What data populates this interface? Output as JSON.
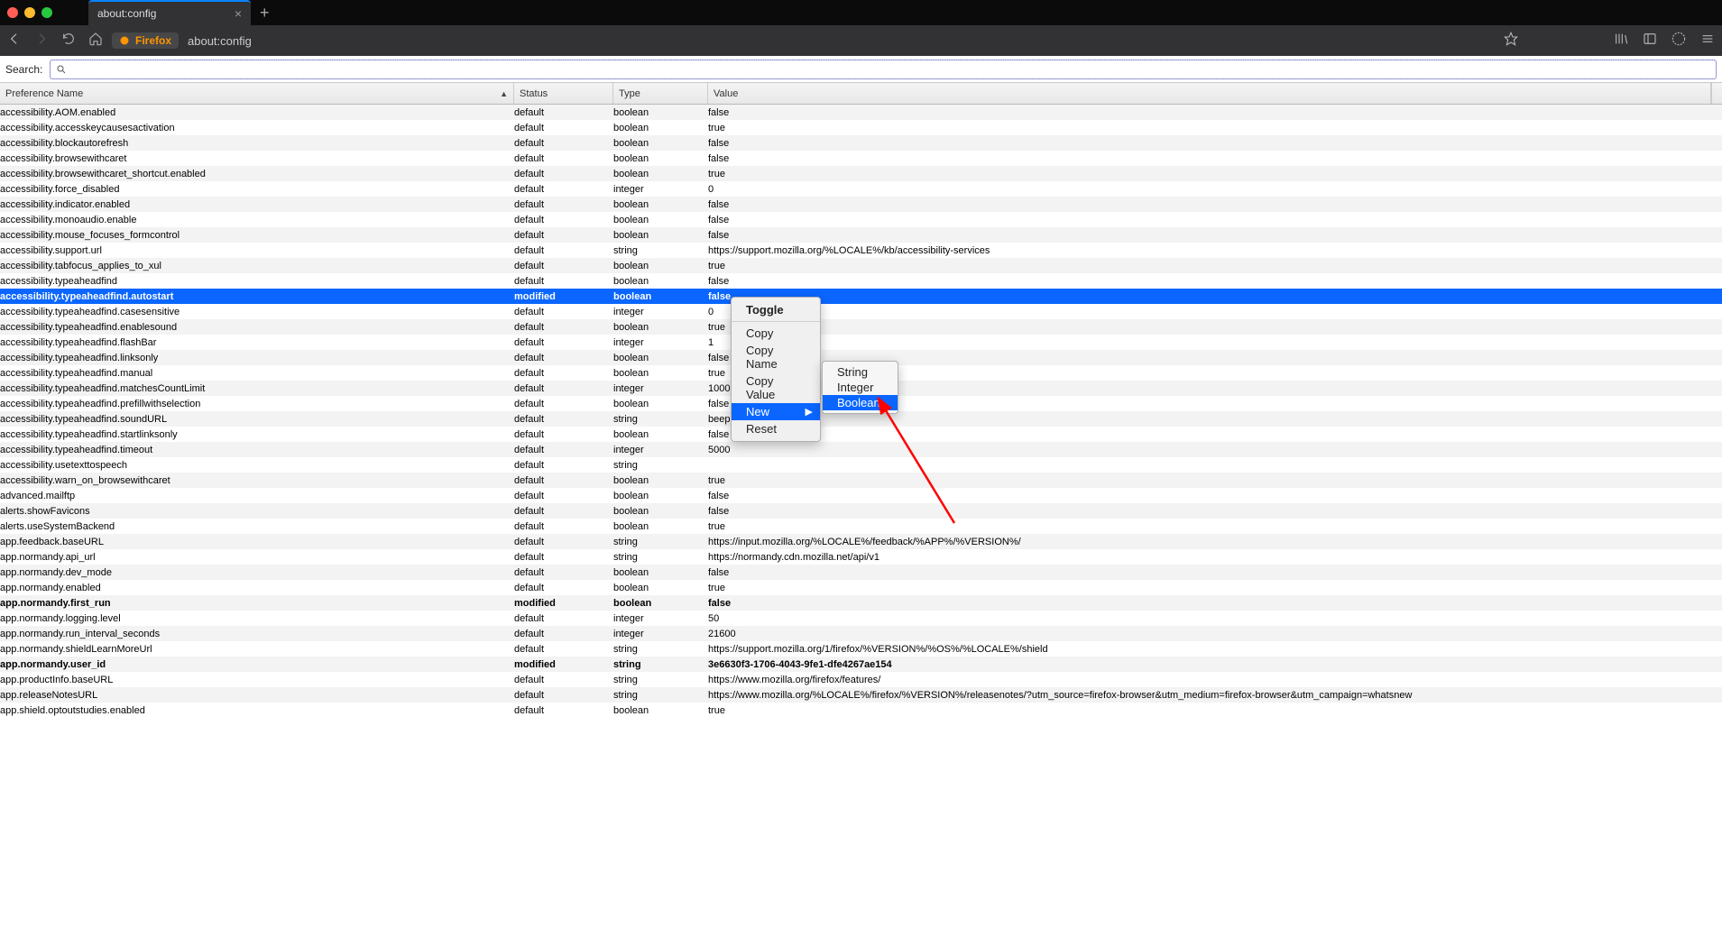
{
  "window": {
    "tab_title": "about:config",
    "firefox_badge": "Firefox",
    "url": "about:config"
  },
  "searchbar": {
    "label": "Search:"
  },
  "columns": {
    "name": "Preference Name",
    "status": "Status",
    "type": "Type",
    "value": "Value"
  },
  "context_menu": {
    "toggle": "Toggle",
    "copy": "Copy",
    "copy_name": "Copy Name",
    "copy_value": "Copy Value",
    "new": "New",
    "reset": "Reset",
    "sub_string": "String",
    "sub_integer": "Integer",
    "sub_boolean": "Boolean"
  },
  "prefs": [
    {
      "n": "accessibility.AOM.enabled",
      "s": "default",
      "t": "boolean",
      "v": "false"
    },
    {
      "n": "accessibility.accesskeycausesactivation",
      "s": "default",
      "t": "boolean",
      "v": "true"
    },
    {
      "n": "accessibility.blockautorefresh",
      "s": "default",
      "t": "boolean",
      "v": "false"
    },
    {
      "n": "accessibility.browsewithcaret",
      "s": "default",
      "t": "boolean",
      "v": "false"
    },
    {
      "n": "accessibility.browsewithcaret_shortcut.enabled",
      "s": "default",
      "t": "boolean",
      "v": "true"
    },
    {
      "n": "accessibility.force_disabled",
      "s": "default",
      "t": "integer",
      "v": "0"
    },
    {
      "n": "accessibility.indicator.enabled",
      "s": "default",
      "t": "boolean",
      "v": "false"
    },
    {
      "n": "accessibility.monoaudio.enable",
      "s": "default",
      "t": "boolean",
      "v": "false"
    },
    {
      "n": "accessibility.mouse_focuses_formcontrol",
      "s": "default",
      "t": "boolean",
      "v": "false"
    },
    {
      "n": "accessibility.support.url",
      "s": "default",
      "t": "string",
      "v": "https://support.mozilla.org/%LOCALE%/kb/accessibility-services"
    },
    {
      "n": "accessibility.tabfocus_applies_to_xul",
      "s": "default",
      "t": "boolean",
      "v": "true"
    },
    {
      "n": "accessibility.typeaheadfind",
      "s": "default",
      "t": "boolean",
      "v": "false"
    },
    {
      "n": "accessibility.typeaheadfind.autostart",
      "s": "modified",
      "t": "boolean",
      "v": "false",
      "selected": true,
      "bold": true
    },
    {
      "n": "accessibility.typeaheadfind.casesensitive",
      "s": "default",
      "t": "integer",
      "v": "0"
    },
    {
      "n": "accessibility.typeaheadfind.enablesound",
      "s": "default",
      "t": "boolean",
      "v": "true"
    },
    {
      "n": "accessibility.typeaheadfind.flashBar",
      "s": "default",
      "t": "integer",
      "v": "1"
    },
    {
      "n": "accessibility.typeaheadfind.linksonly",
      "s": "default",
      "t": "boolean",
      "v": "false"
    },
    {
      "n": "accessibility.typeaheadfind.manual",
      "s": "default",
      "t": "boolean",
      "v": "true"
    },
    {
      "n": "accessibility.typeaheadfind.matchesCountLimit",
      "s": "default",
      "t": "integer",
      "v": "1000"
    },
    {
      "n": "accessibility.typeaheadfind.prefillwithselection",
      "s": "default",
      "t": "boolean",
      "v": "false"
    },
    {
      "n": "accessibility.typeaheadfind.soundURL",
      "s": "default",
      "t": "string",
      "v": "beep"
    },
    {
      "n": "accessibility.typeaheadfind.startlinksonly",
      "s": "default",
      "t": "boolean",
      "v": "false"
    },
    {
      "n": "accessibility.typeaheadfind.timeout",
      "s": "default",
      "t": "integer",
      "v": "5000"
    },
    {
      "n": "accessibility.usetexttospeech",
      "s": "default",
      "t": "string",
      "v": ""
    },
    {
      "n": "accessibility.warn_on_browsewithcaret",
      "s": "default",
      "t": "boolean",
      "v": "true"
    },
    {
      "n": "advanced.mailftp",
      "s": "default",
      "t": "boolean",
      "v": "false"
    },
    {
      "n": "alerts.showFavicons",
      "s": "default",
      "t": "boolean",
      "v": "false"
    },
    {
      "n": "alerts.useSystemBackend",
      "s": "default",
      "t": "boolean",
      "v": "true"
    },
    {
      "n": "app.feedback.baseURL",
      "s": "default",
      "t": "string",
      "v": "https://input.mozilla.org/%LOCALE%/feedback/%APP%/%VERSION%/"
    },
    {
      "n": "app.normandy.api_url",
      "s": "default",
      "t": "string",
      "v": "https://normandy.cdn.mozilla.net/api/v1"
    },
    {
      "n": "app.normandy.dev_mode",
      "s": "default",
      "t": "boolean",
      "v": "false"
    },
    {
      "n": "app.normandy.enabled",
      "s": "default",
      "t": "boolean",
      "v": "true"
    },
    {
      "n": "app.normandy.first_run",
      "s": "modified",
      "t": "boolean",
      "v": "false",
      "bold": true
    },
    {
      "n": "app.normandy.logging.level",
      "s": "default",
      "t": "integer",
      "v": "50"
    },
    {
      "n": "app.normandy.run_interval_seconds",
      "s": "default",
      "t": "integer",
      "v": "21600"
    },
    {
      "n": "app.normandy.shieldLearnMoreUrl",
      "s": "default",
      "t": "string",
      "v": "https://support.mozilla.org/1/firefox/%VERSION%/%OS%/%LOCALE%/shield"
    },
    {
      "n": "app.normandy.user_id",
      "s": "modified",
      "t": "string",
      "v": "3e6630f3-1706-4043-9fe1-dfe4267ae154",
      "bold": true
    },
    {
      "n": "app.productInfo.baseURL",
      "s": "default",
      "t": "string",
      "v": "https://www.mozilla.org/firefox/features/"
    },
    {
      "n": "app.releaseNotesURL",
      "s": "default",
      "t": "string",
      "v": "https://www.mozilla.org/%LOCALE%/firefox/%VERSION%/releasenotes/?utm_source=firefox-browser&utm_medium=firefox-browser&utm_campaign=whatsnew"
    },
    {
      "n": "app.shield.optoutstudies.enabled",
      "s": "default",
      "t": "boolean",
      "v": "true"
    }
  ]
}
